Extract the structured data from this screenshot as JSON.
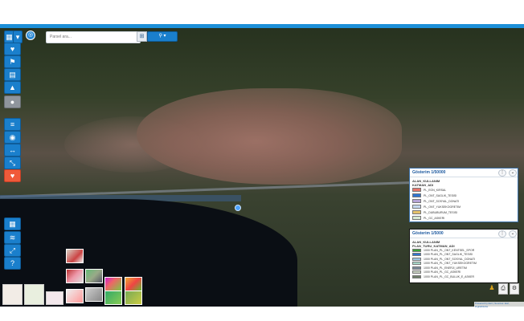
{
  "toolbar": {
    "layers_icon": "layers-icon",
    "compass_icon": "compass-icon",
    "search_placeholder": "Parsel ara...",
    "filter_icon": "filter-icon",
    "search_button_icon": "search-icon"
  },
  "sidebar": {
    "group1": [
      {
        "icon": "heart-health-icon"
      },
      {
        "icon": "walking-person-icon"
      },
      {
        "icon": "building-icon"
      },
      {
        "icon": "graduation-cap-icon"
      },
      {
        "icon": "camera-icon"
      }
    ],
    "group2": [
      {
        "icon": "layers-stack-icon"
      },
      {
        "icon": "satellite-icon"
      },
      {
        "icon": "measure-icon"
      },
      {
        "icon": "resize-icon"
      },
      {
        "icon": "favorite-heart-icon"
      }
    ],
    "group3": [
      {
        "icon": "grid-icon"
      },
      {
        "icon": "wifi-icon"
      },
      {
        "icon": "fullscreen-icon"
      },
      {
        "icon": "help-icon"
      }
    ]
  },
  "legend1": {
    "header": "Gösterim 1/50000",
    "title": "ALAN_KULLANIM",
    "subtitle": "KATMAN_ADI",
    "items": [
      {
        "label": "PL_EON_KIRSAL",
        "color": "#e7746b"
      },
      {
        "label": "PL_ONT_SAGLIK_TESISI",
        "color": "#2f74d0"
      },
      {
        "label": "PL_ONT_SOSYAL_DONATI",
        "color": "#b7a3d6"
      },
      {
        "label": "PL_ONT_YUKSEKOGRETIM",
        "color": "#c6d9f0"
      },
      {
        "label": "PL_DUBUBURUM_TESISI",
        "color": "#e6c26a"
      },
      {
        "label": "PL_GC_ASKERI",
        "color": "#d9ead3"
      }
    ]
  },
  "legend2": {
    "header": "Gösterim 1/5000",
    "title": "ALAN_KULLANIM",
    "subtitle": "PLAN_TURU_KATMAN_ADI",
    "items": [
      {
        "label": "1000 PLAN_PL_ONT_KENTSEL_SPOR",
        "color": "#3aa23a"
      },
      {
        "label": "1000 PLAN_PL_ONT_SAGLIK_TESISI",
        "color": "#2f74d0"
      },
      {
        "label": "1000 PLAN_PL_ONT_SOSYAL_DONATI",
        "color": "#9ec8e8"
      },
      {
        "label": "1000 PLAN_PL_ONT_YUKSEKOGRETIM",
        "color": "#a8d8c8"
      },
      {
        "label": "1000 PLAN_PL_ENERJI_URETIM",
        "color": "#7b8a99"
      },
      {
        "label": "1000 PLAN_PL_GC_ASKERI",
        "color": "#c9d3c2"
      },
      {
        "label": "1000 PLAN_PL_GC_BULUK_E_ASKER",
        "color": "#6f7f6a"
      }
    ]
  },
  "attribution": "Powered by Esri | Sources: Esri, DigitalGlobe"
}
